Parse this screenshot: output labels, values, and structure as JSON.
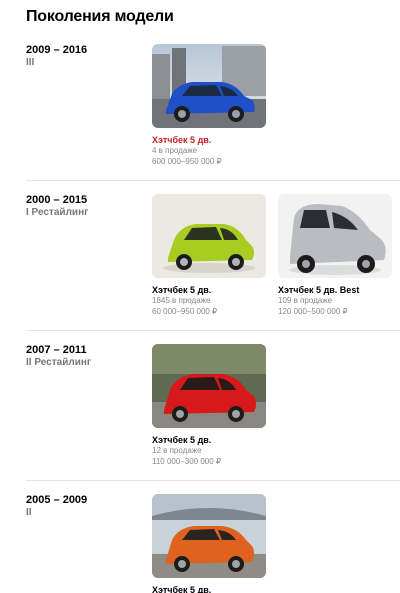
{
  "page": {
    "title": "Поколения модели"
  },
  "generations": [
    {
      "years": "2009 – 2016",
      "subtitle": "III",
      "cars": [
        {
          "name": "Хэтчбек 5 дв.",
          "on_sale": "4 в продаже",
          "price": "600 000–950 000 ₽",
          "color": "#1f4fc9",
          "name_color": "#c81e1e"
        }
      ]
    },
    {
      "years": "2000 – 2015",
      "subtitle": "I Рестайлинг",
      "cars": [
        {
          "name": "Хэтчбек 5 дв.",
          "on_sale": "1845 в продаже",
          "price": "60 000–950 000 ₽",
          "color": "#a8cc22"
        },
        {
          "name": "Хэтчбек 5 дв. Best",
          "on_sale": "109 в продаже",
          "price": "120 000–500 000 ₽",
          "color": "#b9bcc0"
        }
      ]
    },
    {
      "years": "2007 – 2011",
      "subtitle": "II Рестайлинг",
      "cars": [
        {
          "name": "Хэтчбек 5 дв.",
          "on_sale": "12 в продаже",
          "price": "110 000–300 000 ₽",
          "color": "#d8191b"
        }
      ]
    },
    {
      "years": "2005 – 2009",
      "subtitle": "II",
      "cars": [
        {
          "name": "Хэтчбек 5 дв.",
          "on_sale": "",
          "price": "",
          "color": "#e0621f"
        }
      ]
    }
  ]
}
